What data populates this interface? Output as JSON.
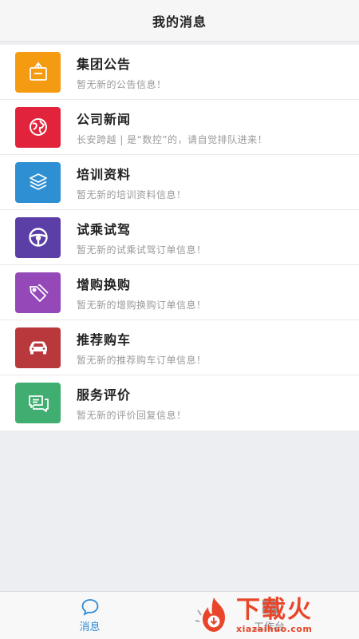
{
  "header": {
    "title": "我的消息"
  },
  "items": [
    {
      "name": "集团公告",
      "desc": "暂无新的公告信息！",
      "color": "#f59b12",
      "icon": "notice-board-icon"
    },
    {
      "name": "公司新闻",
      "desc": "长安跨越 | 是“数控”的，请自觉排队进来！",
      "color": "#e1243c",
      "icon": "globe-icon"
    },
    {
      "name": "培训资料",
      "desc": "暂无新的培训资料信息！",
      "color": "#2e8fd3",
      "icon": "layers-icon"
    },
    {
      "name": "试乘试驾",
      "desc": "暂无新的试乘试驾订单信息！",
      "color": "#5b3fa7",
      "icon": "steering-wheel-icon"
    },
    {
      "name": "增购换购",
      "desc": "暂无新的增购换购订单信息！",
      "color": "#9548b8",
      "icon": "tags-icon"
    },
    {
      "name": "推荐购车",
      "desc": "暂无新的推荐购车订单信息！",
      "color": "#b8383c",
      "icon": "car-icon"
    },
    {
      "name": "服务评价",
      "desc": "暂无新的评价回复信息！",
      "color": "#3fae70",
      "icon": "chat-bubbles-icon"
    }
  ],
  "tabbar": {
    "tabs": [
      {
        "label": "消息",
        "icon": "message-bubble-icon",
        "active": true
      },
      {
        "label": "工作台",
        "icon": "grid-icon",
        "active": false
      }
    ]
  },
  "watermark": {
    "big": "下载火",
    "small": "xiazaihuo.com",
    "color": "#e8452a"
  }
}
